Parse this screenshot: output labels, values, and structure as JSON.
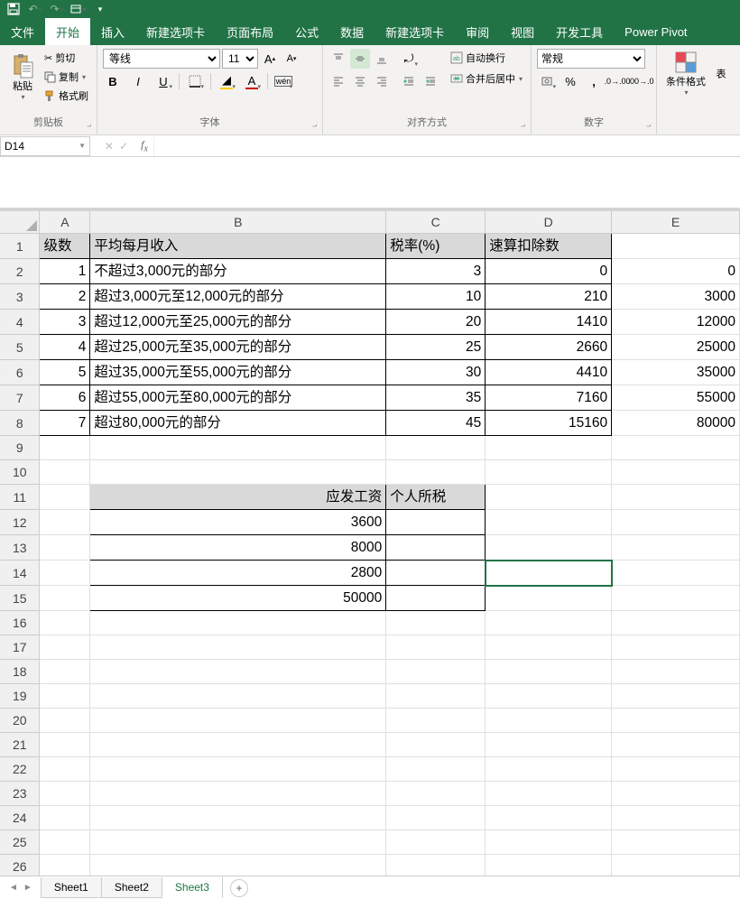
{
  "qat": {
    "save": "💾"
  },
  "tabs": [
    "文件",
    "开始",
    "插入",
    "新建选项卡",
    "页面布局",
    "公式",
    "数据",
    "新建选项卡",
    "审阅",
    "视图",
    "开发工具",
    "Power Pivot"
  ],
  "active_tab": 1,
  "ribbon": {
    "clipboard": {
      "label": "剪贴板",
      "paste": "粘贴",
      "cut": "剪切",
      "copy": "复制",
      "painter": "格式刷"
    },
    "font": {
      "label": "字体",
      "name": "等线",
      "size": "11"
    },
    "align": {
      "label": "对齐方式",
      "wrap": "自动换行",
      "merge": "合并后居中"
    },
    "number": {
      "label": "数字",
      "format": "常规"
    },
    "styles": {
      "cond": "条件格式",
      "tbl": "表"
    }
  },
  "namebox": "D14",
  "cols": [
    "A",
    "B",
    "C",
    "D",
    "E"
  ],
  "table1": {
    "headers": {
      "A": "级数",
      "B": "平均每月收入",
      "C": "税率(%)",
      "D": "速算扣除数"
    },
    "rows": [
      {
        "A": "1",
        "B": "不超过3,000元的部分",
        "C": "3",
        "D": "0",
        "E": "0"
      },
      {
        "A": "2",
        "B": "超过3,000元至12,000元的部分",
        "C": "10",
        "D": "210",
        "E": "3000"
      },
      {
        "A": "3",
        "B": "超过12,000元至25,000元的部分",
        "C": "20",
        "D": "1410",
        "E": "12000"
      },
      {
        "A": "4",
        "B": "超过25,000元至35,000元的部分",
        "C": "25",
        "D": "2660",
        "E": "25000"
      },
      {
        "A": "5",
        "B": "超过35,000元至55,000元的部分",
        "C": "30",
        "D": "4410",
        "E": "35000"
      },
      {
        "A": "6",
        "B": "超过55,000元至80,000元的部分",
        "C": "35",
        "D": "7160",
        "E": "55000"
      },
      {
        "A": "7",
        "B": "超过80,000元的部分",
        "C": "45",
        "D": "15160",
        "E": "80000"
      }
    ]
  },
  "table2": {
    "headers": {
      "B": "应发工资",
      "C": "个人所税"
    },
    "rows": [
      {
        "B": "3600"
      },
      {
        "B": "8000"
      },
      {
        "B": "2800"
      },
      {
        "B": "50000"
      }
    ]
  },
  "sheets": [
    "Sheet1",
    "Sheet2",
    "Sheet3"
  ],
  "active_sheet": 2
}
